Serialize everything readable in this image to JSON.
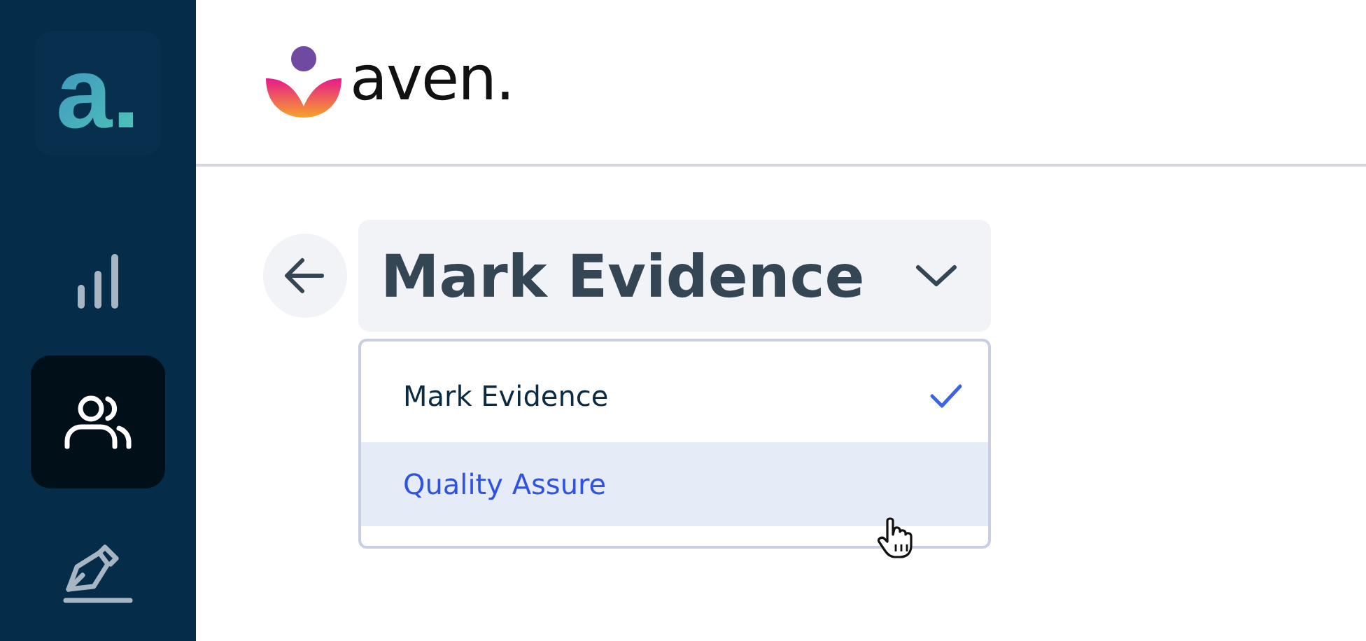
{
  "sidebar": {
    "logo": "a.",
    "items": [
      {
        "kind": "chart",
        "selected": false
      },
      {
        "kind": "people",
        "selected": true
      },
      {
        "kind": "pen",
        "selected": false
      }
    ]
  },
  "header": {
    "brand": "aven."
  },
  "page": {
    "title": "Mark Evidence",
    "menu": [
      {
        "label": "Mark Evidence",
        "selected": true,
        "hovered": false
      },
      {
        "label": "Quality Assure",
        "selected": false,
        "hovered": true
      }
    ]
  }
}
